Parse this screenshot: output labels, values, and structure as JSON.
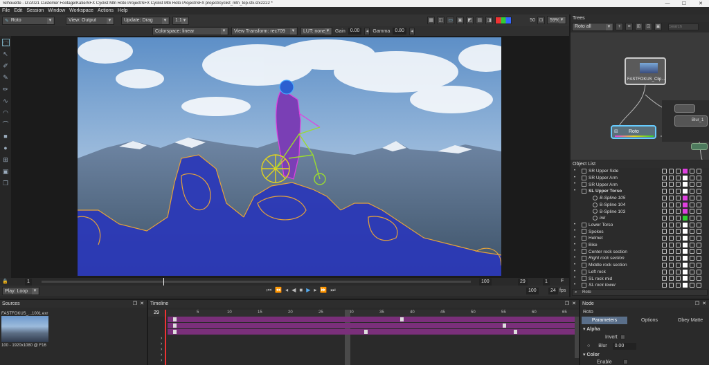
{
  "window": {
    "title": "Silhouette - D:/2021 Customer Footage/Katie/SFX Cyclist Mtn Roto Project/SFX Cyclist Mtn Roto Project/SFX project/cyclist_mtn_top.sfx.sfx2222 *"
  },
  "menu": [
    "File",
    "Edit",
    "Session",
    "Window",
    "Workspace",
    "Actions",
    "Help"
  ],
  "toolbar": {
    "node_select": "Roto",
    "view_select": "View: Output",
    "update_select": "Update: Drag",
    "ratio_select": "1:1",
    "frame_num": "50",
    "zoom": "59%"
  },
  "viewbar": {
    "colorspace": "Colorspace: linear",
    "view_transform": "View Transform: rec709",
    "lut": "LUT: none",
    "gain_label": "Gain",
    "gain_value": "0.00",
    "gamma_label": "Gamma",
    "gamma_value": "0.80"
  },
  "timebar": {
    "start": "1",
    "end": "100",
    "current": "29",
    "step": "1",
    "end_marker": "F"
  },
  "playbar": {
    "play_mode": "Play: Loop",
    "range_end": "100",
    "fps_value": "24",
    "fps_label": "fps"
  },
  "trees": {
    "title": "Trees",
    "select": "Roto all",
    "search_placeholder": "Search",
    "nodes": {
      "clip": "FASTFOKUS_Clip...",
      "roto": "Roto",
      "blur": "Blur_1"
    }
  },
  "object_list": {
    "title": "Object List",
    "search_value": "Roto",
    "items": [
      {
        "name": "SR Upper Side",
        "style": "normal",
        "indent": 0,
        "color": "#e040e0"
      },
      {
        "name": "SR Upper Arm",
        "style": "normal",
        "indent": 0,
        "color": "#ffffff"
      },
      {
        "name": "SR Upper Arm",
        "style": "normal",
        "indent": 0,
        "color": "#ffffff"
      },
      {
        "name": "SL Upper Torso",
        "style": "bold",
        "indent": 0,
        "color": "#ffffff"
      },
      {
        "name": "B-Spline 105",
        "style": "italic",
        "indent": 1,
        "color": "#e040e0"
      },
      {
        "name": "B-Spline 104",
        "style": "normal",
        "indent": 1,
        "color": "#e040e0"
      },
      {
        "name": "B-Spline 103",
        "style": "normal",
        "indent": 1,
        "color": "#e040e0"
      },
      {
        "name": "ink",
        "style": "italic",
        "indent": 1,
        "color": "#30d030"
      },
      {
        "name": "Lower Torso",
        "style": "normal",
        "indent": 0,
        "color": "#ffffff"
      },
      {
        "name": "Spokes",
        "style": "normal",
        "indent": 0,
        "color": "#ffffff"
      },
      {
        "name": "Helmet",
        "style": "normal",
        "indent": 0,
        "color": "#ffffff"
      },
      {
        "name": "Bike",
        "style": "normal",
        "indent": 0,
        "color": "#ffffff"
      },
      {
        "name": "Center rock section",
        "style": "normal",
        "indent": 0,
        "color": "#ffffff"
      },
      {
        "name": "Right rock section",
        "style": "italic",
        "indent": 0,
        "color": "#ffffff"
      },
      {
        "name": "Middle rock section",
        "style": "normal",
        "indent": 0,
        "color": "#ffffff"
      },
      {
        "name": "Left rock",
        "style": "normal",
        "indent": 0,
        "color": "#ffffff"
      },
      {
        "name": "SL rock mid",
        "style": "normal",
        "indent": 0,
        "color": "#ffffff"
      },
      {
        "name": "SL rock lower",
        "style": "italic",
        "indent": 0,
        "color": "#ffffff"
      }
    ]
  },
  "sources": {
    "title": "Sources",
    "clip_name": "FASTFOKUS_...1001.exr",
    "clip_info": "100 - 1920x1080 @ F16"
  },
  "timeline": {
    "title": "Timeline",
    "current_frame": "29",
    "ticks": [
      "5",
      "10",
      "15",
      "20",
      "25",
      "30",
      "35",
      "40",
      "45",
      "50",
      "55",
      "60",
      "65"
    ]
  },
  "node_panel": {
    "title": "Node",
    "node_name": "Roto",
    "tabs": [
      "Parameters",
      "Options",
      "Obey Matte"
    ],
    "alpha_section": "Alpha",
    "invert_label": "Invert",
    "blur_label": "Blur",
    "blur_value": "0.00",
    "color_section": "Color",
    "enable_label": "Enable"
  }
}
